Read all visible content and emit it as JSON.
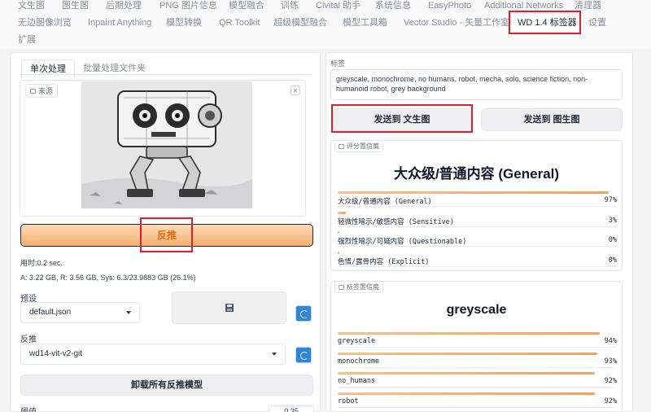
{
  "nav": {
    "row1": [
      "文生图",
      "图生图",
      "后期处理",
      "PNG 图片信息",
      "模型融合",
      "训练",
      "Civitai 助手",
      "系统信息",
      "EasyPhoto",
      "Additional Networks",
      "清理器"
    ],
    "row2": [
      "无边图像浏览",
      "Inpaint Anything",
      "模型转换",
      "QR Toolkit",
      "超级模型融合",
      "模型工具箱",
      "Vector Studio - 矢量工作室",
      "WD 1.4 标签器",
      "设置"
    ],
    "row3": [
      "扩展"
    ]
  },
  "left": {
    "tabs": [
      "单次处理",
      "批量处理文件夹"
    ],
    "image_label": "来源",
    "interrogate_label": "反推",
    "time_text": "用时:0.2 sec.",
    "mem_text": "A: 3.22 GB, R: 3.56 GB, Sys: 6.3/23.9883 GB (26.1%)",
    "preset_label": "预设",
    "preset_value": "default.json",
    "interrogator_label": "反推",
    "interrogator_value": "wd14-vit-v2-git",
    "unload_label": "卸载所有反推模型",
    "threshold_label": "阈值",
    "threshold_value": "0.35"
  },
  "right": {
    "tags_label": "标签",
    "tags_text": "greyscale, monochrome, no humans, robot, mecha, solo, science fiction, non-humanoid robot, grey background",
    "send_txt2img": "发送到 文生图",
    "send_img2img": "发送到 图生图",
    "rating": {
      "label": "评分置信度",
      "title": "大众级/普通内容 (General)",
      "items": [
        {
          "name": "大众级/普通内容 (General)",
          "pct": "97%",
          "value": 0.97
        },
        {
          "name": "轻微性暗示/敏感内容 (Sensitive)",
          "pct": "3%",
          "value": 0.03
        },
        {
          "name": "强烈性暗示/可疑内容 (Questionable)",
          "pct": "0%",
          "value": 0.0
        },
        {
          "name": "色情/露骨内容 (Explicit)",
          "pct": "0%",
          "value": 0.0
        }
      ]
    },
    "tag_conf": {
      "label": "标签置信度",
      "title": "greyscale",
      "items": [
        {
          "name": "greyscale",
          "pct": "94%",
          "value": 0.94
        },
        {
          "name": "monochrome",
          "pct": "93%",
          "value": 0.93
        },
        {
          "name": "no_humans",
          "pct": "92%",
          "value": 0.92
        },
        {
          "name": "robot",
          "pct": "92%",
          "value": 0.92
        }
      ]
    }
  },
  "colors": {
    "highlight": "#e11d2e",
    "orange_text": "#e26a12",
    "bar": "#f4a15a",
    "refresh": "#2f86d8"
  }
}
